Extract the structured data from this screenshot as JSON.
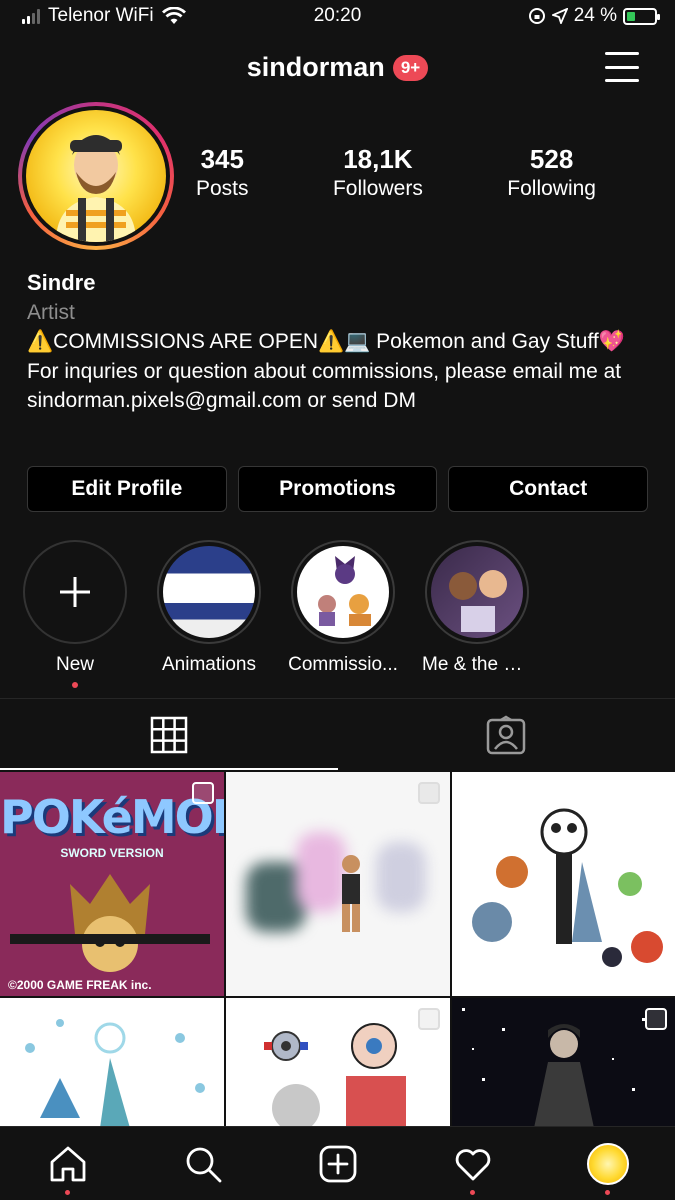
{
  "status_bar": {
    "carrier": "Telenor WiFi",
    "time": "20:20",
    "battery_pct": "24 %"
  },
  "header": {
    "username": "sindorman",
    "notification_badge": "9+"
  },
  "profile": {
    "stats": [
      {
        "value": "345",
        "label": "Posts"
      },
      {
        "value": "18,1K",
        "label": "Followers"
      },
      {
        "value": "528",
        "label": "Following"
      }
    ],
    "name": "Sindre",
    "category": "Artist",
    "bio": "⚠️COMMISSIONS ARE OPEN⚠️💻 Pokemon and Gay Stuff💖 For inquries or question about commissions, please email me at sindorman.pixels@gmail.com or send DM"
  },
  "actions": {
    "edit_profile": "Edit Profile",
    "promotions": "Promotions",
    "contact": "Contact"
  },
  "highlights": [
    {
      "label": "New"
    },
    {
      "label": "Animations"
    },
    {
      "label": "Commissio..."
    },
    {
      "label": "Me & the Q..."
    }
  ],
  "grid_posts": {
    "post1_title": "POKéMON",
    "post1_subtitle": "SWORD VERSION",
    "post1_footer": "©2000 GAME FREAK inc."
  },
  "colors": {
    "background": "#121212",
    "accent_red": "#ed4956",
    "border": "#363636"
  },
  "icons": {
    "grid_tab": "grid-icon",
    "tagged_tab": "tagged-person-icon",
    "nav": [
      "home-icon",
      "search-icon",
      "add-post-icon",
      "heart-icon",
      "profile-avatar"
    ]
  }
}
